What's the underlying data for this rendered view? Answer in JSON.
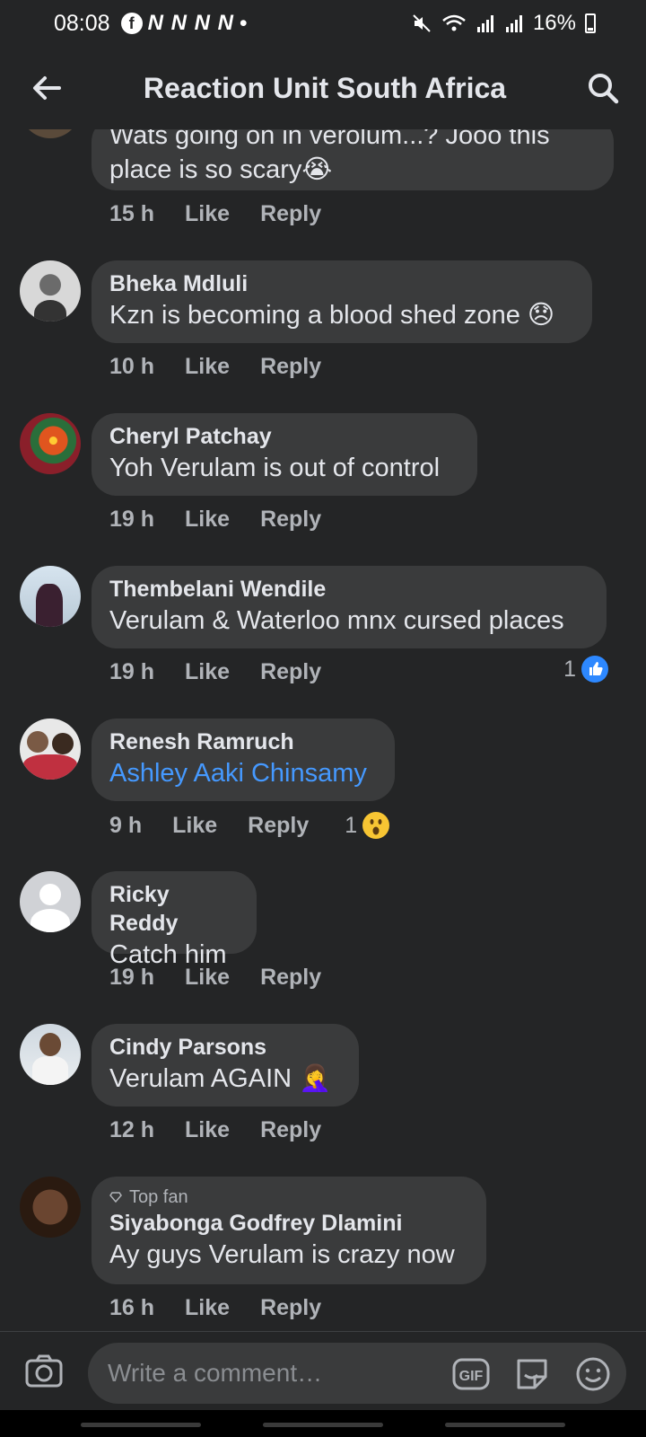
{
  "status_bar": {
    "time": "08:08",
    "notif_icons": "N N N N",
    "dot": "•",
    "battery": "16%"
  },
  "header": {
    "title": "Reaction Unit South Africa",
    "back_icon": "arrow-left-icon",
    "search_icon": "search-icon"
  },
  "comments": [
    {
      "author": "",
      "text_line1": "Wats going on in verolum...? Jooo this",
      "text_line2": "place is so scary😭",
      "time": "15 h",
      "like": "Like",
      "reply": "Reply"
    },
    {
      "author": "Bheka Mdluli",
      "text": "Kzn is becoming a blood shed zone 😞",
      "time": "10 h",
      "like": "Like",
      "reply": "Reply"
    },
    {
      "author": "Cheryl Patchay",
      "text": "Yoh Verulam is out of control",
      "time": "19 h",
      "like": "Like",
      "reply": "Reply"
    },
    {
      "author": "Thembelani Wendile",
      "text": "Verulam & Waterloo  mnx cursed places",
      "time": "19 h",
      "like": "Like",
      "reply": "Reply",
      "reaction_count": "1",
      "reaction_icon": "thumbs-up-icon"
    },
    {
      "author": "Renesh Ramruch",
      "text": "Ashley Aaki Chinsamy",
      "time": "9 h",
      "like": "Like",
      "reply": "Reply",
      "reaction_count": "1",
      "reaction_icon": "wow-emoji-icon"
    },
    {
      "author": "Ricky Reddy",
      "text": "Catch him",
      "time": "19 h",
      "like": "Like",
      "reply": "Reply"
    },
    {
      "author": "Cindy Parsons",
      "text": "Verulam AGAIN 🤦‍♀️",
      "time": "12 h",
      "like": "Like",
      "reply": "Reply"
    },
    {
      "badge": "Top fan",
      "author": "Siyabonga Godfrey Dlamini",
      "text": "Ay guys Verulam is crazy now",
      "time": "16 h",
      "like": "Like",
      "reply": "Reply"
    }
  ],
  "compose": {
    "placeholder": "Write a comment…",
    "camera_icon": "camera-icon",
    "gif_icon": "gif-icon",
    "sticker_icon": "sticker-icon",
    "emoji_icon": "smiley-icon"
  },
  "colors": {
    "background": "#242526",
    "bubble": "#3a3b3c",
    "link": "#4599ff",
    "muted": "#b0b3b8",
    "like_blue": "#2d88ff"
  }
}
